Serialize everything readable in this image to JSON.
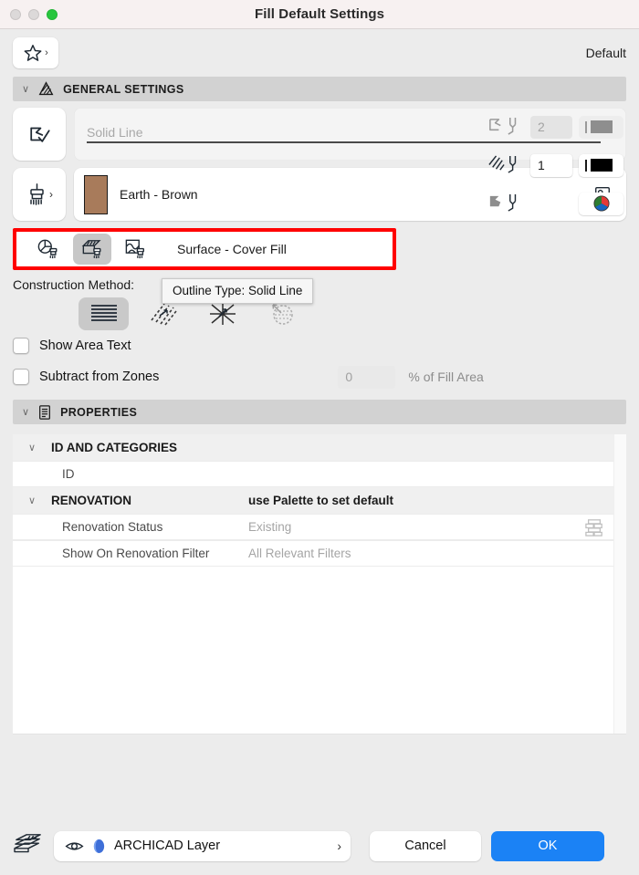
{
  "window": {
    "title": "Fill Default Settings",
    "traffic_lights": [
      "close",
      "minimize",
      "maximize"
    ],
    "accent_green": "#28C63E"
  },
  "favorites": {
    "icon": "star-icon",
    "chevron": "›",
    "default_label": "Default"
  },
  "general_settings": {
    "header": "GENERAL SETTINGS",
    "header_icon": "fill-hatch-icon",
    "caret": "∨",
    "outline": {
      "button_icon": "outline-type-icon",
      "value": "Solid Line",
      "chevron": "›",
      "pen_icon": "outline-pen-icon",
      "pen_number": "2",
      "pen_color": "#8E8E8E",
      "pen_enabled": false
    },
    "material": {
      "button_icon": "brush-icon",
      "button_chevron": "›",
      "swatch_color": "#A87B5B",
      "name": "Earth - Brown",
      "preview_icon": "image-preview-icon",
      "chevron": "›",
      "pen_icon": "fill-pen-icon",
      "pen_number": "1",
      "pen_color": "#000000",
      "pen_enabled": true
    },
    "background": {
      "pen_icon": "background-pen-icon",
      "swatch_icon": "color-wheel-icon"
    }
  },
  "tooltip": {
    "text": "Outline Type: Solid Line"
  },
  "surface": {
    "highlight_color": "#FF0000",
    "label": "Surface - Cover Fill",
    "options": [
      {
        "icon": "pie-fill-brush-icon",
        "selected": false
      },
      {
        "icon": "surface-cover-fill-icon",
        "selected": true
      },
      {
        "icon": "free-shape-fill-icon",
        "selected": false
      }
    ]
  },
  "construction_method": {
    "label": "Construction Method:",
    "options": [
      {
        "icon": "solid-fill-icon",
        "selected": true,
        "enabled": true
      },
      {
        "icon": "hatch-fill-icon",
        "selected": false,
        "enabled": true
      },
      {
        "icon": "pattern-fill-icon",
        "selected": false,
        "enabled": true
      },
      {
        "icon": "gradient-fill-icon",
        "selected": false,
        "enabled": false
      }
    ]
  },
  "checkboxes": [
    {
      "label": "Show Area Text",
      "checked": false
    },
    {
      "label": "Subtract from Zones",
      "checked": false
    }
  ],
  "fill_area": {
    "value": "0",
    "unit_label": "% of Fill Area"
  },
  "properties": {
    "header": "PROPERTIES",
    "header_icon": "properties-list-icon",
    "caret": "∨",
    "rows": [
      {
        "type": "group",
        "caret": "∨",
        "name": "ID AND CATEGORIES",
        "value": ""
      },
      {
        "type": "sub",
        "caret": "",
        "name": "ID",
        "value": ""
      },
      {
        "type": "group",
        "caret": "∨",
        "name": "RENOVATION",
        "value": "use Palette to set default"
      },
      {
        "type": "sub",
        "caret": "",
        "name": "Renovation Status",
        "value": "Existing",
        "icon": "brick-wall-icon"
      },
      {
        "type": "sub",
        "caret": "",
        "name": "Show On Renovation Filter",
        "value": "All Relevant Filters"
      }
    ]
  },
  "footer": {
    "layers_icon": "layers-stack-icon",
    "eye_icon": "eye-icon",
    "layer_color_icon": "layer-color-icon",
    "layer_name": "ARCHICAD Layer",
    "layer_chevron": "›",
    "cancel_label": "Cancel",
    "ok_label": "OK",
    "ok_color": "#1B82F5"
  }
}
